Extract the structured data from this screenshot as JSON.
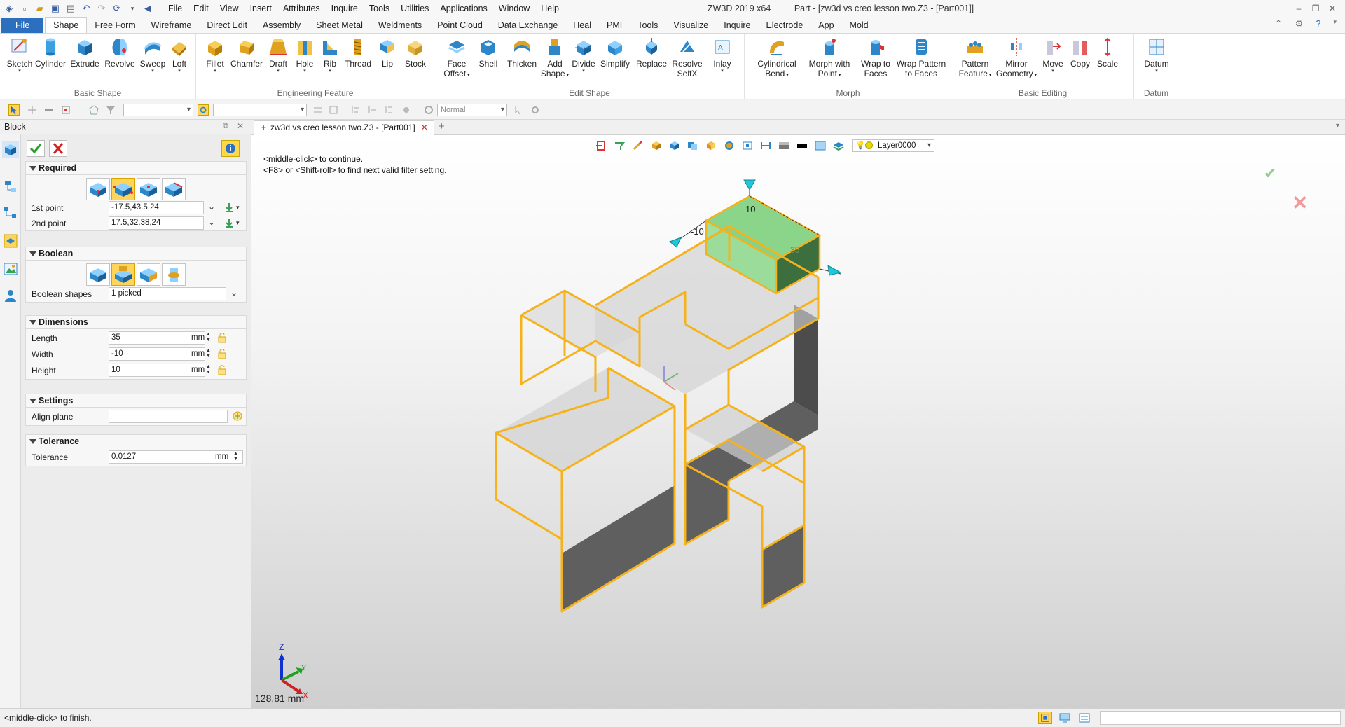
{
  "titlebar": {
    "menus": [
      "File",
      "Edit",
      "View",
      "Insert",
      "Attributes",
      "Inquire",
      "Tools",
      "Utilities",
      "Applications",
      "Window",
      "Help"
    ],
    "app_version": "ZW3D 2019  x64",
    "doc_title": "Part - [zw3d vs creo lesson two.Z3 - [Part001]]"
  },
  "ribbon_tabs": [
    "File",
    "Shape",
    "Free Form",
    "Wireframe",
    "Direct Edit",
    "Assembly",
    "Sheet Metal",
    "Weldments",
    "Point Cloud",
    "Data Exchange",
    "Heal",
    "PMI",
    "Tools",
    "Visualize",
    "Inquire",
    "Electrode",
    "App",
    "Mold"
  ],
  "ribbon_active_tab": "Shape",
  "ribbon_groups": {
    "basic_shape": {
      "label": "Basic Shape",
      "buttons": [
        "Sketch",
        "Cylinder",
        "Extrude",
        "Revolve",
        "Sweep",
        "Loft"
      ]
    },
    "engineering_feature": {
      "label": "Engineering Feature",
      "buttons": [
        "Fillet",
        "Chamfer",
        "Draft",
        "Hole",
        "Rib",
        "Thread",
        "Lip",
        "Stock"
      ]
    },
    "edit_shape": {
      "label": "Edit Shape",
      "buttons": [
        [
          "Face",
          "Offset"
        ],
        [
          "Shell"
        ],
        [
          "Thicken"
        ],
        [
          "Add",
          "Shape"
        ],
        [
          "Divide"
        ],
        [
          "Simplify"
        ],
        [
          "Replace"
        ],
        [
          "Resolve",
          "SelfX"
        ],
        [
          "Inlay"
        ]
      ]
    },
    "morph": {
      "label": "Morph",
      "buttons": [
        [
          "Cylindrical",
          "Bend"
        ],
        [
          "Morph with",
          "Point"
        ],
        [
          "Wrap to",
          "Faces"
        ],
        [
          "Wrap Pattern",
          "to Faces"
        ]
      ]
    },
    "basic_editing": {
      "label": "Basic Editing",
      "buttons": [
        [
          "Pattern",
          "Feature"
        ],
        [
          "Mirror",
          "Geometry"
        ],
        [
          "Move"
        ],
        [
          "Copy"
        ],
        [
          "Scale"
        ]
      ]
    },
    "datum": {
      "label": "Datum",
      "buttons": [
        [
          "Datum"
        ]
      ]
    }
  },
  "toolbar2": {
    "render_mode": "Normal"
  },
  "panel": {
    "title": "Block",
    "sections": {
      "required": "Required",
      "boolean": "Boolean",
      "dimensions": "Dimensions",
      "settings": "Settings",
      "tolerance": "Tolerance"
    },
    "fields": {
      "first_point": {
        "label": "1st point",
        "value": "-17.5,43.5,24"
      },
      "second_point": {
        "label": "2nd point",
        "value": "17.5,32.38,24"
      },
      "boolean_shapes": {
        "label": "Boolean shapes",
        "value": "1 picked"
      },
      "length": {
        "label": "Length",
        "value": "35",
        "unit": "mm"
      },
      "width": {
        "label": "Width",
        "value": "-10",
        "unit": "mm"
      },
      "height": {
        "label": "Height",
        "value": "10",
        "unit": "mm"
      },
      "align_plane": {
        "label": "Align plane",
        "value": ""
      },
      "tolerance": {
        "label": "Tolerance",
        "value": "0.0127",
        "unit": "mm"
      }
    }
  },
  "doc_tab": {
    "label": "zw3d vs creo lesson two.Z3 - [Part001]"
  },
  "viewport": {
    "messages": [
      "<middle-click> to continue.",
      "<F8> or <Shift-roll> to find next valid filter setting."
    ],
    "layer": "Layer0000",
    "distance_readout": "128.81 mm",
    "dim_labels": {
      "height": "10",
      "width": "-10",
      "length": "35"
    },
    "triad_labels": {
      "x": "X",
      "y": "Y",
      "z": "Z"
    }
  },
  "statusbar": {
    "message": "<middle-click> to finish."
  },
  "colors": {
    "accent": "#2d6fbf",
    "highlight_edge": "#f5b21a",
    "preview_fill": "#7ed07e",
    "dark_face": "#5a5a5a"
  }
}
